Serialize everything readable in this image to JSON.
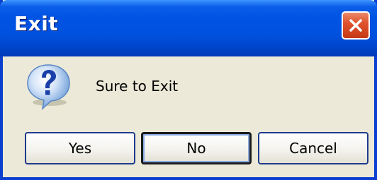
{
  "dialog": {
    "title": "Exit",
    "message": "Sure to Exit",
    "icon": "question-icon",
    "buttons": {
      "yes": "Yes",
      "no": "No",
      "cancel": "Cancel"
    }
  },
  "colors": {
    "titlebar": "#0054e3",
    "frame_border": "#0a3fd0",
    "body_bg": "#ece9d8",
    "close_button": "#e0532d"
  }
}
